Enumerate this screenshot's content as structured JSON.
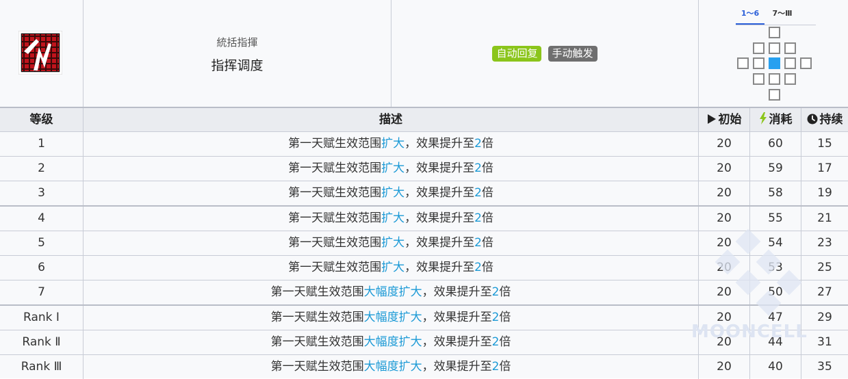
{
  "skill": {
    "subtitle": "統括指揮",
    "name": "指挥调度",
    "icon": "skill-command-icon",
    "tags": [
      {
        "label": "自动回复",
        "color": "#8bc51b"
      },
      {
        "label": "手动触发",
        "color": "#6f6f6f"
      }
    ]
  },
  "range": {
    "tabs": [
      "1～6",
      "7～Ⅲ"
    ],
    "active_tab": 0
  },
  "table": {
    "headers": {
      "level": "等级",
      "description": "描述",
      "initial": "初始",
      "cost": "消耗",
      "duration": "持续"
    },
    "rows": [
      {
        "level": "1",
        "desc_pre": "第一天赋生效范围",
        "desc_hl": "扩大",
        "desc_mid": "，效果提升至",
        "desc_num": "2",
        "desc_post": "倍",
        "initial": "20",
        "cost": "60",
        "duration": "15"
      },
      {
        "level": "2",
        "desc_pre": "第一天赋生效范围",
        "desc_hl": "扩大",
        "desc_mid": "，效果提升至",
        "desc_num": "2",
        "desc_post": "倍",
        "initial": "20",
        "cost": "59",
        "duration": "17"
      },
      {
        "level": "3",
        "desc_pre": "第一天赋生效范围",
        "desc_hl": "扩大",
        "desc_mid": "，效果提升至",
        "desc_num": "2",
        "desc_post": "倍",
        "initial": "20",
        "cost": "58",
        "duration": "19"
      },
      {
        "level": "4",
        "desc_pre": "第一天赋生效范围",
        "desc_hl": "扩大",
        "desc_mid": "，效果提升至",
        "desc_num": "2",
        "desc_post": "倍",
        "initial": "20",
        "cost": "55",
        "duration": "21"
      },
      {
        "level": "5",
        "desc_pre": "第一天赋生效范围",
        "desc_hl": "扩大",
        "desc_mid": "，效果提升至",
        "desc_num": "2",
        "desc_post": "倍",
        "initial": "20",
        "cost": "54",
        "duration": "23"
      },
      {
        "level": "6",
        "desc_pre": "第一天赋生效范围",
        "desc_hl": "扩大",
        "desc_mid": "，效果提升至",
        "desc_num": "2",
        "desc_post": "倍",
        "initial": "20",
        "cost": "53",
        "duration": "25"
      },
      {
        "level": "7",
        "desc_pre": "第一天赋生效范围",
        "desc_hl": "大幅度扩大",
        "desc_mid": "，效果提升至",
        "desc_num": "2",
        "desc_post": "倍",
        "initial": "20",
        "cost": "50",
        "duration": "27"
      },
      {
        "level": "Rank Ⅰ",
        "desc_pre": "第一天赋生效范围",
        "desc_hl": "大幅度扩大",
        "desc_mid": "，效果提升至",
        "desc_num": "2",
        "desc_post": "倍",
        "initial": "20",
        "cost": "47",
        "duration": "29"
      },
      {
        "level": "Rank Ⅱ",
        "desc_pre": "第一天赋生效范围",
        "desc_hl": "大幅度扩大",
        "desc_mid": "，效果提升至",
        "desc_num": "2",
        "desc_post": "倍",
        "initial": "20",
        "cost": "44",
        "duration": "31"
      },
      {
        "level": "Rank Ⅲ",
        "desc_pre": "第一天赋生效范围",
        "desc_hl": "大幅度扩大",
        "desc_mid": "，效果提升至",
        "desc_num": "2",
        "desc_post": "倍",
        "initial": "20",
        "cost": "40",
        "duration": "35"
      }
    ]
  },
  "colors": {
    "highlight": "#1c9ad6",
    "range_center": "#27a0f0",
    "tab_active": "#2b5fd9",
    "cost_icon": "#8bc51b"
  },
  "watermark": "MOONCELL"
}
